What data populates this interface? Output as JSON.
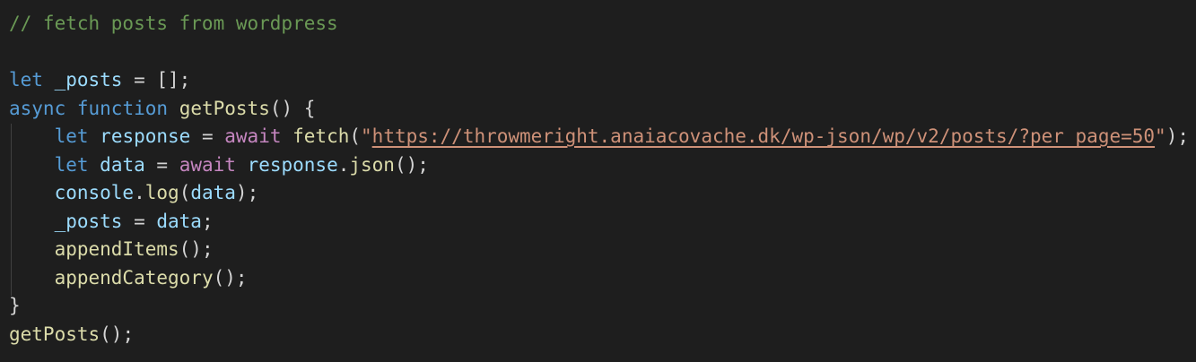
{
  "editor": {
    "lines": [
      {
        "tokens": [
          {
            "t": "// fetch posts from wordpress",
            "c": "comment"
          }
        ]
      },
      {
        "tokens": []
      },
      {
        "tokens": [
          {
            "t": "let",
            "c": "keyword"
          },
          {
            "t": " ",
            "c": "punct"
          },
          {
            "t": "_posts",
            "c": "variable"
          },
          {
            "t": " = [];",
            "c": "punct"
          }
        ]
      },
      {
        "tokens": [
          {
            "t": "async",
            "c": "keyword"
          },
          {
            "t": " ",
            "c": "punct"
          },
          {
            "t": "function",
            "c": "keyword"
          },
          {
            "t": " ",
            "c": "punct"
          },
          {
            "t": "getPosts",
            "c": "function"
          },
          {
            "t": "() {",
            "c": "punct"
          }
        ]
      },
      {
        "tokens": [
          {
            "t": "    ",
            "c": "punct"
          },
          {
            "t": "let",
            "c": "keyword"
          },
          {
            "t": " ",
            "c": "punct"
          },
          {
            "t": "response",
            "c": "variable"
          },
          {
            "t": " = ",
            "c": "punct"
          },
          {
            "t": "await",
            "c": "control"
          },
          {
            "t": " ",
            "c": "punct"
          },
          {
            "t": "fetch",
            "c": "function"
          },
          {
            "t": "(",
            "c": "punct"
          },
          {
            "t": "\"",
            "c": "string"
          },
          {
            "t": "https://throwmeright.anaiacovache.dk/wp-json/wp/v2/posts/?per_page=50",
            "c": "url"
          },
          {
            "t": "\"",
            "c": "string"
          },
          {
            "t": ");",
            "c": "punct"
          }
        ]
      },
      {
        "tokens": [
          {
            "t": "    ",
            "c": "punct"
          },
          {
            "t": "let",
            "c": "keyword"
          },
          {
            "t": " ",
            "c": "punct"
          },
          {
            "t": "data",
            "c": "variable"
          },
          {
            "t": " = ",
            "c": "punct"
          },
          {
            "t": "await",
            "c": "control"
          },
          {
            "t": " ",
            "c": "punct"
          },
          {
            "t": "response",
            "c": "variable"
          },
          {
            "t": ".",
            "c": "punct"
          },
          {
            "t": "json",
            "c": "function"
          },
          {
            "t": "();",
            "c": "punct"
          }
        ]
      },
      {
        "tokens": [
          {
            "t": "    ",
            "c": "punct"
          },
          {
            "t": "console",
            "c": "variable"
          },
          {
            "t": ".",
            "c": "punct"
          },
          {
            "t": "log",
            "c": "function"
          },
          {
            "t": "(",
            "c": "punct"
          },
          {
            "t": "data",
            "c": "variable"
          },
          {
            "t": ");",
            "c": "punct"
          }
        ]
      },
      {
        "tokens": [
          {
            "t": "    ",
            "c": "punct"
          },
          {
            "t": "_posts",
            "c": "variable"
          },
          {
            "t": " = ",
            "c": "punct"
          },
          {
            "t": "data",
            "c": "variable"
          },
          {
            "t": ";",
            "c": "punct"
          }
        ]
      },
      {
        "tokens": [
          {
            "t": "    ",
            "c": "punct"
          },
          {
            "t": "appendItems",
            "c": "function"
          },
          {
            "t": "();",
            "c": "punct"
          }
        ]
      },
      {
        "tokens": [
          {
            "t": "    ",
            "c": "punct"
          },
          {
            "t": "appendCategory",
            "c": "function"
          },
          {
            "t": "();",
            "c": "punct"
          }
        ]
      },
      {
        "tokens": [
          {
            "t": "}",
            "c": "punct"
          }
        ]
      },
      {
        "tokens": [
          {
            "t": "getPosts",
            "c": "function"
          },
          {
            "t": "();",
            "c": "punct"
          }
        ]
      }
    ]
  },
  "colors": {
    "background": "#1e1e1e",
    "comment": "#6a9955",
    "keyword": "#569cd6",
    "control": "#c586c0",
    "function": "#dcdcaa",
    "variable": "#9cdcfe",
    "string": "#ce9178",
    "punctuation": "#d4d4d4"
  }
}
